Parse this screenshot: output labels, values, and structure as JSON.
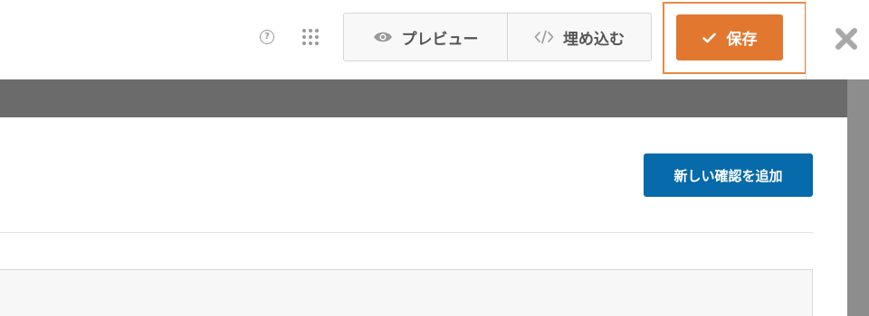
{
  "toolbar": {
    "help_icon": "help-circle-icon",
    "grid_icon": "apps-grid-icon",
    "help_glyph": "?",
    "preview_label": "プレビュー",
    "embed_label": "埋め込む",
    "save_label": "保存",
    "close_icon": "close-x-icon"
  },
  "panel": {
    "add_confirmation_label": "新しい確認を追加"
  },
  "colors": {
    "save": "#e27730",
    "primary": "#066aab",
    "overlay": "#6b6b6b"
  }
}
